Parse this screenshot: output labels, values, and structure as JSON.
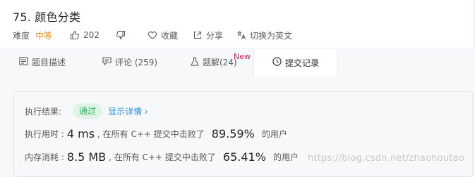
{
  "problem": {
    "title": "75. 颜色分类",
    "difficulty_label": "难度",
    "difficulty": "中等",
    "likes": "202",
    "favorite_label": "收藏",
    "share_label": "分享",
    "lang_switch_label": "切换为英文"
  },
  "tabs": [
    {
      "label": "题目描述",
      "icon": "doc-icon"
    },
    {
      "label": "评论 (259)",
      "icon": "comment-icon"
    },
    {
      "label": "题解(24)",
      "icon": "flask-icon",
      "badge": "New"
    },
    {
      "label": "提交记录",
      "icon": "clock-icon",
      "active": true
    }
  ],
  "result": {
    "status_label": "执行结果:",
    "status": "通过",
    "detail_link": "显示详情",
    "detail_arrow": "›",
    "runtime_label": "执行用时 :",
    "runtime_value": "4 ms",
    "runtime_mid": ", 在所有 C++ 提交中击败了",
    "runtime_pct": "89.59%",
    "runtime_suffix": "的用户",
    "memory_label": "内存消耗 :",
    "memory_value": "8.5 MB",
    "memory_mid": ", 在所有 C++ 提交中击败了",
    "memory_pct": "65.41%",
    "memory_suffix": "的用户"
  },
  "watermark": "https://blog.csdn.net/zhaohoutao",
  "colors": {
    "difficulty": "#ef8d16",
    "status_bg": "#e1f5e7",
    "status_text": "#2db55d",
    "link": "#2a8ee0",
    "new_badge": "#e0194f"
  }
}
